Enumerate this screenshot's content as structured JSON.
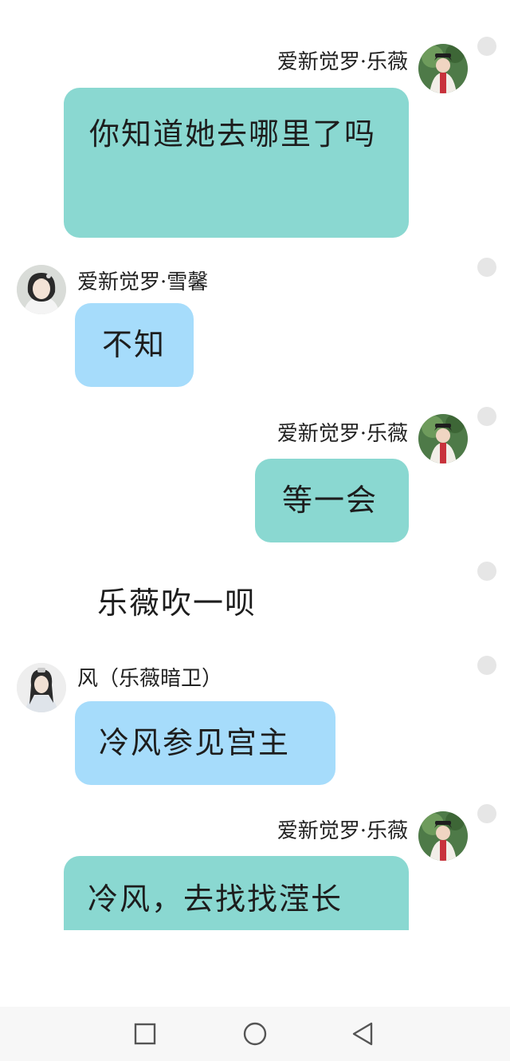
{
  "messages": [
    {
      "sender": "爱新觉罗·乐薇",
      "text": "你知道她去哪里了吗"
    },
    {
      "sender": "爱新觉罗·雪馨",
      "text": "不知"
    },
    {
      "sender": "爱新觉罗·乐薇",
      "text": "等一会"
    },
    {
      "narration": "乐薇吹一呗"
    },
    {
      "sender": "风（乐薇暗卫）",
      "text": "冷风参见宫主"
    },
    {
      "sender": "爱新觉罗·乐薇",
      "text": "冷风，去找找滢长"
    }
  ],
  "icons": {
    "navbar": [
      "recent-apps-icon",
      "home-icon",
      "back-icon"
    ]
  },
  "colors": {
    "self_bubble": "#8ad8d1",
    "other_bubble": "#a6dcfb",
    "selection_dot": "#e6e6e6",
    "navbar": "#f7f7f7"
  }
}
